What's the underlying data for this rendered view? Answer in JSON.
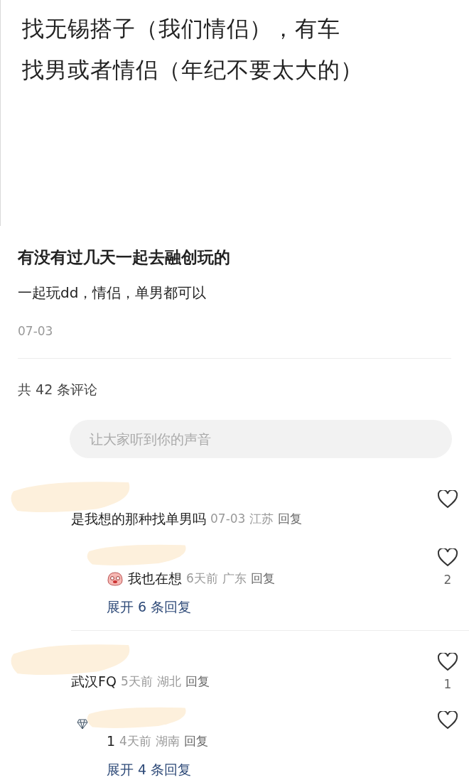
{
  "image_text": {
    "lines": [
      "找无锡搭子（我们情侣），有车",
      "找男或者情侣（年纪不要太大的）"
    ]
  },
  "note": {
    "title": "有没有过几天一起去融创玩的",
    "body": "一起玩dd，情侣，单男都可以",
    "date": "07-03"
  },
  "comments_count": "共 42 条评论",
  "comment_input": {
    "placeholder": "让大家听到你的声音"
  },
  "comments": [
    {
      "text": "是我想的那种找单男吗",
      "time": "07-03",
      "location": "江苏",
      "reply": "回复",
      "liked": false,
      "replies": [
        {
          "text": "我也在想",
          "sticker": true,
          "badge": false,
          "time": "6天前",
          "location": "广东",
          "reply": "回复",
          "liked": false,
          "likes": "2"
        }
      ],
      "expand": "展开 6 条回复"
    },
    {
      "text": "武汉FQ",
      "time": "5天前",
      "location": "湖北",
      "reply": "回复",
      "liked": false,
      "likes": "1",
      "replies": [
        {
          "text": "1",
          "sticker": false,
          "badge": true,
          "time": "4天前",
          "location": "湖南",
          "reply": "回复",
          "liked": false
        }
      ],
      "expand": "展开 4 条回复"
    }
  ]
}
